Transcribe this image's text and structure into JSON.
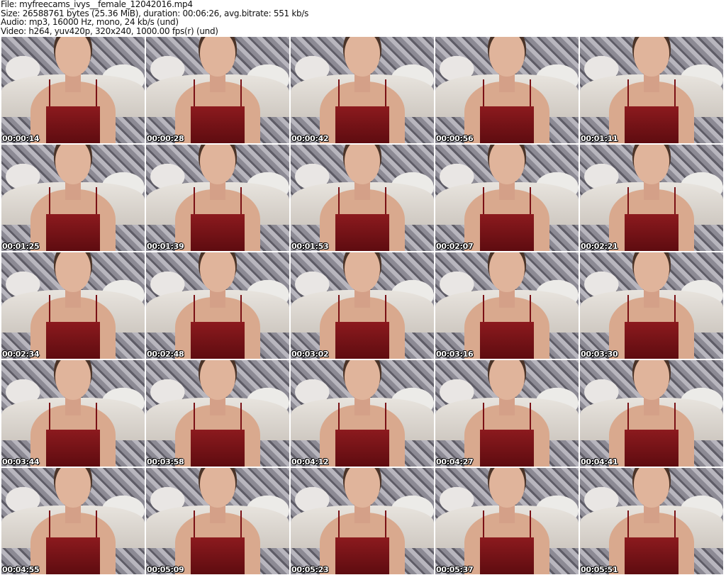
{
  "header": {
    "file": "File: myfreecams_ivys__female_12042016.mp4",
    "size": "Size: 26588761 bytes (25.36 MiB), duration: 00:06:26, avg.bitrate: 551 kb/s",
    "audio": "Audio: mp3, 16000 Hz, mono, 24 kb/s (und)",
    "video": "Video: h264, yuv420p, 320x240, 1000.00 fps(r) (und)"
  },
  "thumbnails": [
    "00:00:14",
    "00:00:28",
    "00:00:42",
    "00:00:56",
    "00:01:11",
    "00:01:25",
    "00:01:39",
    "00:01:53",
    "00:02:07",
    "00:02:21",
    "00:02:34",
    "00:02:48",
    "00:03:02",
    "00:03:16",
    "00:03:30",
    "00:03:44",
    "00:03:58",
    "00:04:12",
    "00:04:27",
    "00:04:41",
    "00:04:55",
    "00:05:09",
    "00:05:23",
    "00:05:37",
    "00:05:51"
  ]
}
